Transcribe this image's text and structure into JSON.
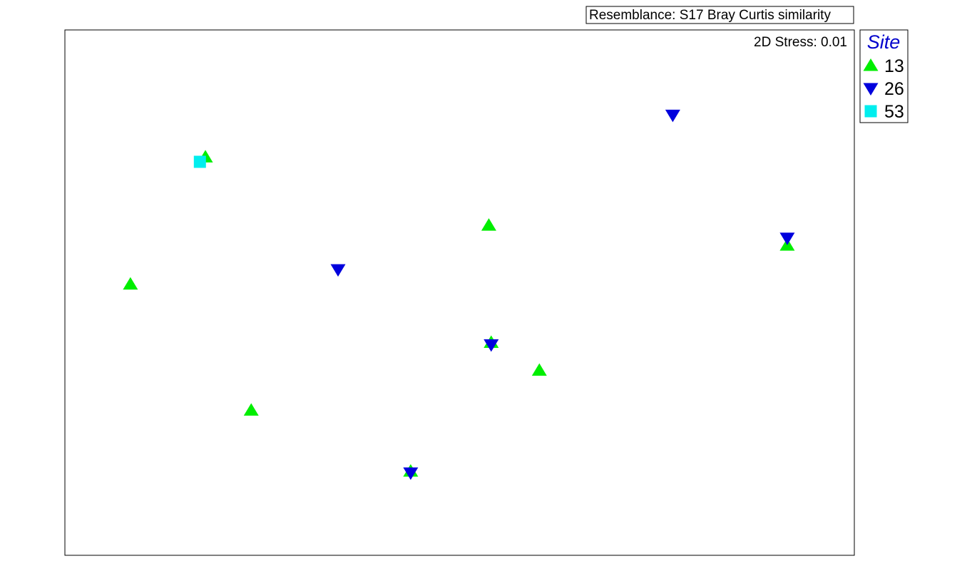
{
  "chart_data": {
    "type": "scatter",
    "title": "",
    "xlabel": "",
    "ylabel": "",
    "grid": false,
    "axes_ticks": false,
    "annotations": {
      "resemblance": "Resemblance: S17 Bray Curtis similarity",
      "stress": "2D Stress: 0.01"
    },
    "legend": {
      "title": "Site",
      "title_color": "#0000cc",
      "placement": "right-top-outside"
    },
    "xlim": [
      0,
      100
    ],
    "ylim": [
      0,
      100
    ],
    "series": [
      {
        "name": "13",
        "marker": "triangle-up",
        "color": "#00ee00",
        "points": [
          {
            "x": 17.8,
            "y": 75.8
          },
          {
            "x": 8.3,
            "y": 51.6
          },
          {
            "x": 53.7,
            "y": 62.8
          },
          {
            "x": 91.5,
            "y": 59.0
          },
          {
            "x": 54.0,
            "y": 40.5
          },
          {
            "x": 60.1,
            "y": 35.2
          },
          {
            "x": 23.6,
            "y": 27.6
          },
          {
            "x": 43.8,
            "y": 16.0
          }
        ]
      },
      {
        "name": "26",
        "marker": "triangle-down",
        "color": "#0000dd",
        "points": [
          {
            "x": 77.0,
            "y": 83.8
          },
          {
            "x": 91.5,
            "y": 60.4
          },
          {
            "x": 34.6,
            "y": 54.4
          },
          {
            "x": 54.0,
            "y": 40.1
          },
          {
            "x": 43.8,
            "y": 15.7
          }
        ]
      },
      {
        "name": "53",
        "marker": "square",
        "color": "#00eeee",
        "points": [
          {
            "x": 17.1,
            "y": 74.9
          }
        ]
      }
    ]
  }
}
